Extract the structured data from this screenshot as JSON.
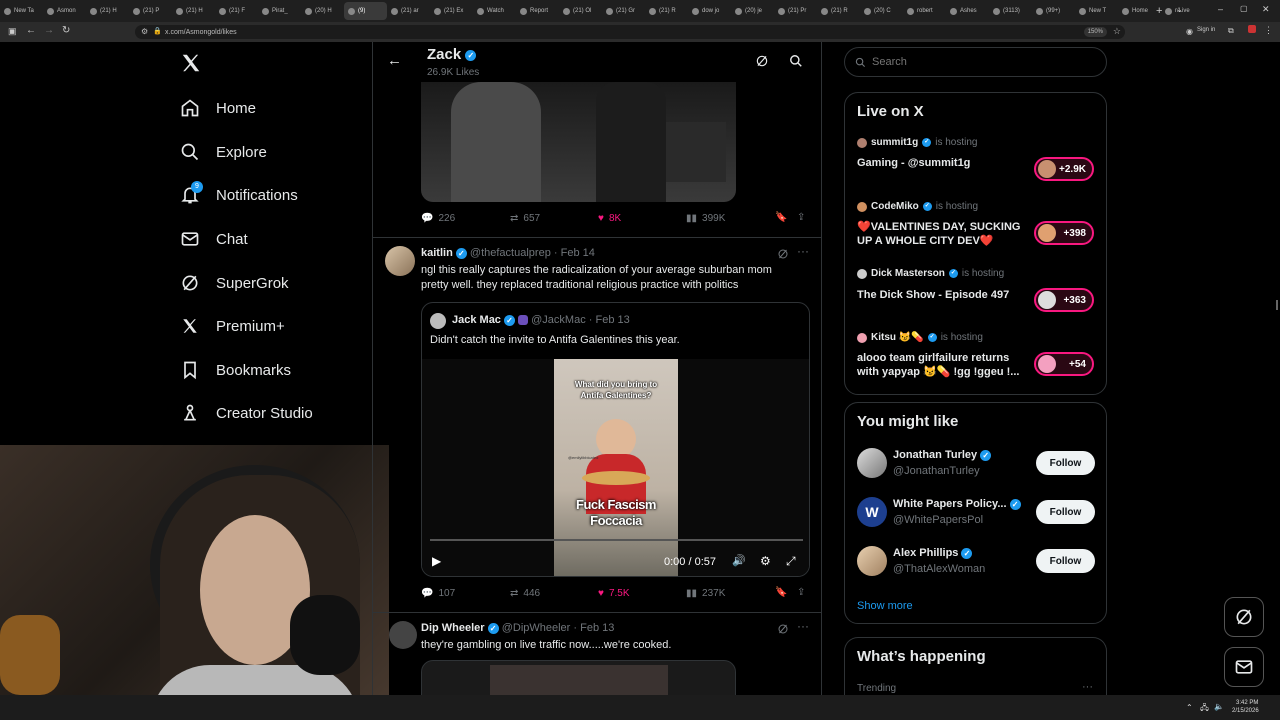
{
  "browser": {
    "tabs": [
      "New Ta",
      "Asmon",
      "(21) H",
      "(21) P",
      "(21) H",
      "(21) F",
      "Pirat_",
      "(20) H",
      "(9)",
      "(21) ar",
      "(21) Ex",
      "Watch",
      "Report",
      "(21) Ol",
      "(21) Gr",
      "(21) R",
      "dow jo",
      "(20) je",
      "(21) Pr",
      "(21) R",
      "(20) C",
      "robert",
      "Ashes",
      "(3113)",
      "(99+)",
      "New T",
      "Home",
      "r/Live"
    ],
    "active_tab_index": 8,
    "url": "x.com/Asmongold/likes",
    "zoom": "150%",
    "signin": "Sign in"
  },
  "nav": {
    "items": [
      {
        "label": "Home",
        "icon": "home-icon"
      },
      {
        "label": "Explore",
        "icon": "search-icon"
      },
      {
        "label": "Notifications",
        "icon": "bell-icon",
        "badge": "9"
      },
      {
        "label": "Chat",
        "icon": "mail-icon"
      },
      {
        "label": "SuperGrok",
        "icon": "grok-icon"
      },
      {
        "label": "Premium+",
        "icon": "x-logo-icon"
      },
      {
        "label": "Bookmarks",
        "icon": "bookmark-icon"
      },
      {
        "label": "Creator Studio",
        "icon": "creator-icon"
      }
    ]
  },
  "profile": {
    "name": "Zack",
    "likes": "26.9K Likes"
  },
  "tweet1": {
    "metrics": {
      "replies": "226",
      "reposts": "657",
      "likes": "8K",
      "views": "399K"
    }
  },
  "tweet2": {
    "name": "kaitlin",
    "handle": "@thefactualprep",
    "date": "Feb 14",
    "text_line1": "ngl this really captures the radicalization of your average suburban mom",
    "text_line2": "pretty well. they replaced traditional religious practice with politics",
    "quote": {
      "name": "Jack Mac",
      "handle": "@JackMac",
      "date": "Feb 13",
      "text": "Didn't catch the invite to Antifa Galentines this year.",
      "video_caption": "What did you bring to Antifa Galentines?",
      "video_sign_line1": "Fuck Fascism",
      "video_sign_line2": "Foccacia",
      "video_watermark": "@emilylibbicated",
      "time": "0:00 / 0:57",
      "progress": 0
    },
    "metrics": {
      "replies": "107",
      "reposts": "446",
      "likes": "7.5K",
      "views": "237K"
    }
  },
  "tweet3": {
    "name": "Dip Wheeler",
    "handle": "@DipWheeler",
    "date": "Feb 13",
    "text": "they're gambling on live traffic now.....we're cooked."
  },
  "search": {
    "placeholder": "Search"
  },
  "live": {
    "title": "Live on X",
    "hosting_label": "is hosting",
    "items": [
      {
        "host": "summit1g",
        "title_line1": "Gaming - @summit1g",
        "title_line2": "",
        "count": "+2.9K"
      },
      {
        "host": "CodeMiko",
        "title_line1": "❤️VALENTINES DAY, SUCKING",
        "title_line2": "UP A WHOLE CITY DEV❤️",
        "count": "+398"
      },
      {
        "host": "Dick Masterson",
        "title_line1": "The Dick Show - Episode 497",
        "title_line2": "",
        "count": "+363"
      },
      {
        "host": "Kitsu 😼💊",
        "title_line1": "alooo team girlfailure returns",
        "title_line2": "with yapyap 😼💊 !gg !ggeu !...",
        "count": "+54"
      }
    ]
  },
  "suggest": {
    "title": "You might like",
    "follow_label": "Follow",
    "show_more": "Show more",
    "items": [
      {
        "name": "Jonathan Turley",
        "handle": "@JonathanTurley"
      },
      {
        "name": "White Papers Policy...",
        "handle": "@WhitePapersPol",
        "avatar_letter": "W"
      },
      {
        "name": "Alex Phillips",
        "handle": "@ThatAlexWoman"
      }
    ]
  },
  "happening": {
    "title": "What’s happening",
    "trending": "Trending"
  },
  "taskbar": {
    "time": "3:42 PM",
    "date": "2/15/2026"
  },
  "colors": {
    "accent": "#1d9bf0",
    "like": "#f91880",
    "live_ring": "#f91880"
  }
}
